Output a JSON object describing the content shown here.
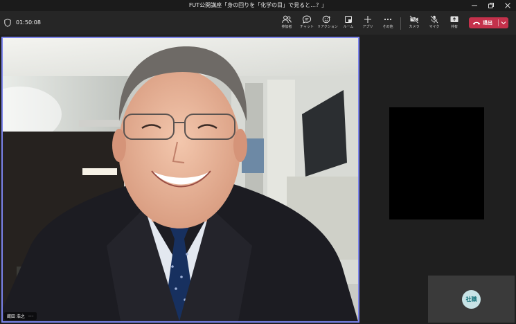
{
  "window": {
    "title": "FUT公開講座「身の回りを「化学の目」で見ると…？」"
  },
  "meeting": {
    "timer": "01:50:08"
  },
  "toolbar": {
    "participants": "参加者",
    "chat": "チャット",
    "reactions": "リアクション",
    "rooms": "ルーム",
    "apps": "アプリ",
    "more": "その他",
    "camera": "カメラ",
    "mic": "マイク",
    "share": "共有",
    "leave": "退出"
  },
  "video": {
    "speaker_name": "蔵田 浩之",
    "more_options": "···"
  },
  "self_view": {
    "initials": "社職"
  },
  "colors": {
    "accent_border": "#7b83eb",
    "leave_button": "#c4314b",
    "avatar_bg": "#c8e3e6",
    "avatar_text": "#18747c"
  }
}
